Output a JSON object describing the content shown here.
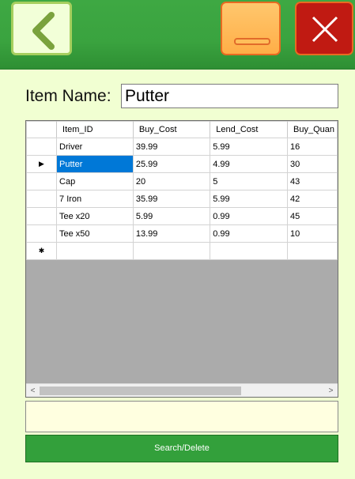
{
  "header": {
    "back_icon": "chevron-left-icon",
    "minimize_icon": "minimize-icon",
    "close_icon": "close-x-icon",
    "colors": {
      "bar": "#3aa33f",
      "back": "#f2ffd8",
      "minimize": "#ffae47",
      "close": "#c01a12"
    }
  },
  "form": {
    "item_label": "Item Name:",
    "item_value": "Putter"
  },
  "grid": {
    "columns": [
      "Item_ID",
      "Buy_Cost",
      "Lend_Cost",
      "Buy_Quan"
    ],
    "rows": [
      {
        "indicator": "",
        "cells": [
          "Driver",
          "39.99",
          "5.99",
          "16"
        ]
      },
      {
        "indicator": "▶",
        "cells": [
          "Putter",
          "25.99",
          "4.99",
          "30"
        ]
      },
      {
        "indicator": "",
        "cells": [
          "Cap",
          "20",
          "5",
          "43"
        ]
      },
      {
        "indicator": "",
        "cells": [
          "7 Iron",
          "35.99",
          "5.99",
          "42"
        ]
      },
      {
        "indicator": "",
        "cells": [
          "Tee x20",
          "5.99",
          "0.99",
          "45"
        ]
      },
      {
        "indicator": "",
        "cells": [
          "Tee x50",
          "13.99",
          "0.99",
          "10"
        ]
      }
    ],
    "new_row_indicator": "✱",
    "selected_cell": "Putter",
    "scroll_left": "<",
    "scroll_right": ">"
  },
  "message": "",
  "search_button": "Search/Delete"
}
